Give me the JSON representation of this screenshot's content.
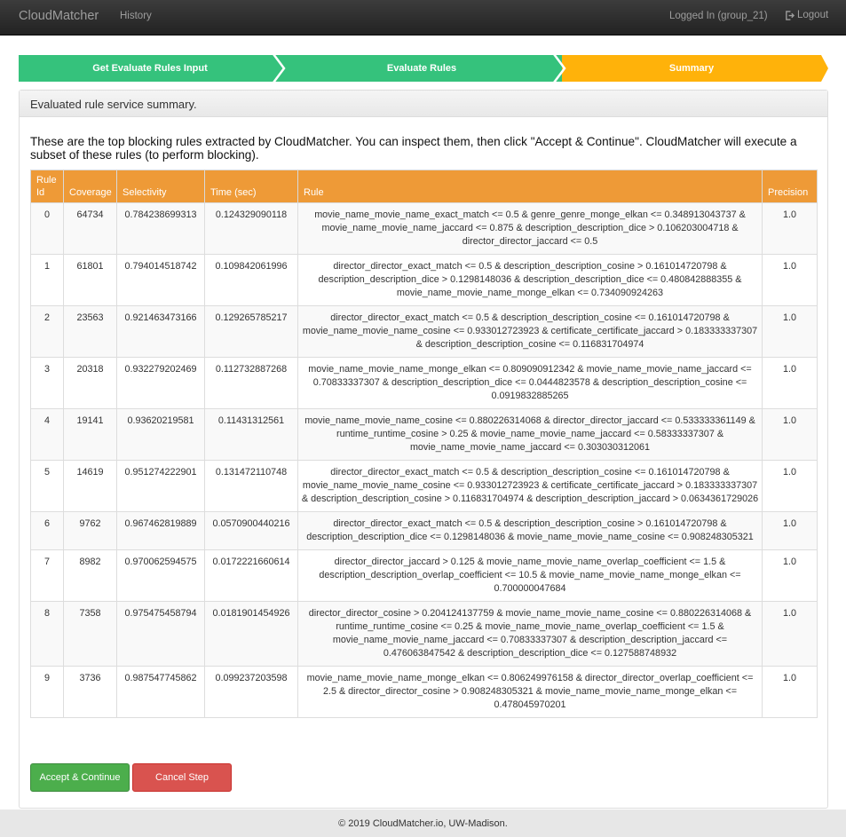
{
  "navbar": {
    "brand": "CloudMatcher",
    "history": "History",
    "user": "Logged In (group_21)",
    "logout": "Logout"
  },
  "steps": [
    {
      "label": "Get Evaluate Rules Input",
      "color": "#35c27c"
    },
    {
      "label": "Evaluate Rules",
      "color": "#35c27c"
    },
    {
      "label": "Summary",
      "color": "#ffb20a"
    }
  ],
  "panel": {
    "heading": "Evaluated rule service summary.",
    "intro": "These are the top blocking rules extracted by CloudMatcher. You can inspect them, then click \"Accept & Continue\". CloudMatcher will execute a subset of these rules (to perform blocking)."
  },
  "table": {
    "headers": {
      "rule_id": "Rule Id",
      "coverage": "Coverage",
      "selectivity": "Selectivity",
      "time": "Time (sec)",
      "rule": "Rule",
      "precision": "Precision"
    },
    "rows": [
      {
        "id": "0",
        "coverage": "64734",
        "selectivity": "0.784238699313",
        "time": "0.124329090118",
        "rule": "movie_name_movie_name_exact_match <= 0.5 & genre_genre_monge_elkan <= 0.348913043737 & movie_name_movie_name_jaccard <= 0.875 & description_description_dice > 0.106203004718 & director_director_jaccard <= 0.5",
        "precision": "1.0"
      },
      {
        "id": "1",
        "coverage": "61801",
        "selectivity": "0.794014518742",
        "time": "0.109842061996",
        "rule": "director_director_exact_match <= 0.5 & description_description_cosine > 0.161014720798 & description_description_dice > 0.1298148036 & description_description_dice <= 0.480842888355 & movie_name_movie_name_monge_elkan <= 0.734090924263",
        "precision": "1.0"
      },
      {
        "id": "2",
        "coverage": "23563",
        "selectivity": "0.921463473166",
        "time": "0.129265785217",
        "rule": "director_director_exact_match <= 0.5 & description_description_cosine <= 0.161014720798 & movie_name_movie_name_cosine <= 0.933012723923 & certificate_certificate_jaccard > 0.183333337307 & description_description_cosine <= 0.116831704974",
        "precision": "1.0"
      },
      {
        "id": "3",
        "coverage": "20318",
        "selectivity": "0.932279202469",
        "time": "0.112732887268",
        "rule": "movie_name_movie_name_monge_elkan <= 0.809090912342 & movie_name_movie_name_jaccard <= 0.70833337307 & description_description_dice <= 0.0444823578 & description_description_cosine <= 0.0919832885265",
        "precision": "1.0"
      },
      {
        "id": "4",
        "coverage": "19141",
        "selectivity": "0.93620219581",
        "time": "0.11431312561",
        "rule": "movie_name_movie_name_cosine <= 0.880226314068 & director_director_jaccard <= 0.533333361149 & runtime_runtime_cosine > 0.25 & movie_name_movie_name_jaccard <= 0.58333337307 & movie_name_movie_name_jaccard <= 0.303030312061",
        "precision": "1.0"
      },
      {
        "id": "5",
        "coverage": "14619",
        "selectivity": "0.951274222901",
        "time": "0.131472110748",
        "rule": "director_director_exact_match <= 0.5 & description_description_cosine <= 0.161014720798 & movie_name_movie_name_cosine <= 0.933012723923 & certificate_certificate_jaccard > 0.183333337307 & description_description_cosine > 0.116831704974 & description_description_jaccard > 0.0634361729026",
        "precision": "1.0"
      },
      {
        "id": "6",
        "coverage": "9762",
        "selectivity": "0.967462819889",
        "time": "0.0570900440216",
        "rule": "director_director_exact_match <= 0.5 & description_description_cosine > 0.161014720798 & description_description_dice <= 0.1298148036 & movie_name_movie_name_cosine <= 0.908248305321",
        "precision": "1.0"
      },
      {
        "id": "7",
        "coverage": "8982",
        "selectivity": "0.970062594575",
        "time": "0.0172221660614",
        "rule": "director_director_jaccard > 0.125 & movie_name_movie_name_overlap_coefficient <= 1.5 & description_description_overlap_coefficient <= 10.5 & movie_name_movie_name_monge_elkan <= 0.700000047684",
        "precision": "1.0"
      },
      {
        "id": "8",
        "coverage": "7358",
        "selectivity": "0.975475458794",
        "time": "0.0181901454926",
        "rule": "director_director_cosine > 0.204124137759 & movie_name_movie_name_cosine <= 0.880226314068 & runtime_runtime_cosine <= 0.25 & movie_name_movie_name_overlap_coefficient <= 1.5 & movie_name_movie_name_jaccard <= 0.70833337307 & description_description_jaccard <= 0.476063847542 & description_description_dice <= 0.127588748932",
        "precision": "1.0"
      },
      {
        "id": "9",
        "coverage": "3736",
        "selectivity": "0.987547745862",
        "time": "0.099237203598",
        "rule": "movie_name_movie_name_monge_elkan <= 0.806249976158 & director_director_overlap_coefficient <= 2.5 & director_director_cosine > 0.908248305321 & movie_name_movie_name_monge_elkan <= 0.478045970201",
        "precision": "1.0"
      }
    ]
  },
  "buttons": {
    "accept": "Accept & Continue",
    "cancel": "Cancel Step"
  },
  "footer": {
    "text": "© 2019 CloudMatcher.io, UW-Madison."
  },
  "colors": {
    "step_done": "#35c27c",
    "step_active": "#ffb20a",
    "table_header": "#ee9a37",
    "accept": "#4cae4c",
    "cancel": "#d9534f"
  },
  "icons": {
    "logout": "logout-icon"
  }
}
